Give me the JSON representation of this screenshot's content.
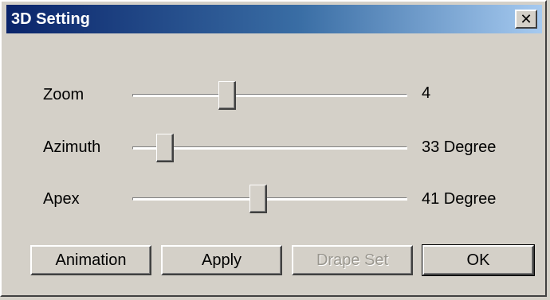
{
  "window": {
    "title": "3D Setting",
    "close_glyph": "✕"
  },
  "sliders": [
    {
      "label": "Zoom",
      "value_text": "4",
      "position_fraction": 0.35
    },
    {
      "label": "Azimuth",
      "value_text": "33 Degree",
      "position_fraction": 0.12
    },
    {
      "label": "Apex",
      "value_text": "41 Degree",
      "position_fraction": 0.47
    }
  ],
  "buttons": {
    "animation": "Animation",
    "apply": "Apply",
    "drape_set": "Drape Set",
    "ok": "OK"
  },
  "colors": {
    "face": "#d4d0c8",
    "title_start": "#0a246a",
    "title_end": "#a6caf0",
    "disabled_text": "#9a978f"
  }
}
